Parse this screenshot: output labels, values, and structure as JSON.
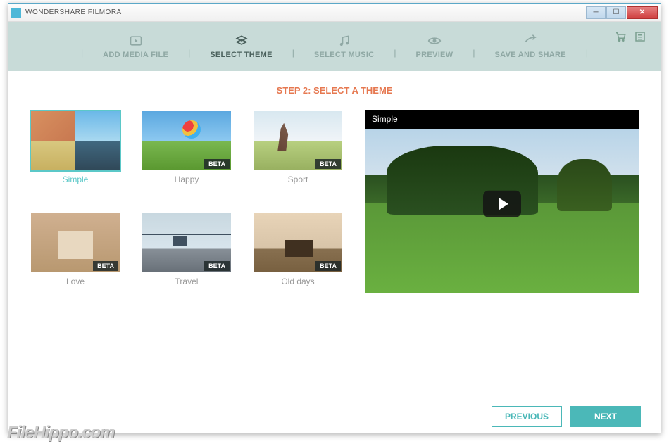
{
  "window": {
    "title": "WONDERSHARE FILMORA"
  },
  "nav": {
    "items": [
      {
        "label": "ADD MEDIA FILE",
        "icon": "media-icon"
      },
      {
        "label": "SELECT THEME",
        "icon": "theme-icon"
      },
      {
        "label": "SELECT MUSIC",
        "icon": "music-icon"
      },
      {
        "label": "PREVIEW",
        "icon": "preview-icon"
      },
      {
        "label": "SAVE AND SHARE",
        "icon": "share-icon"
      }
    ],
    "active_index": 1
  },
  "step": {
    "title": "STEP 2: SELECT A THEME"
  },
  "themes": [
    {
      "name": "Simple",
      "selected": true,
      "beta": false
    },
    {
      "name": "Happy",
      "selected": false,
      "beta": true
    },
    {
      "name": "Sport",
      "selected": false,
      "beta": true
    },
    {
      "name": "Love",
      "selected": false,
      "beta": true
    },
    {
      "name": "Travel",
      "selected": false,
      "beta": true
    },
    {
      "name": "Old days",
      "selected": false,
      "beta": true
    }
  ],
  "beta_label": "BETA",
  "preview": {
    "title": "Simple"
  },
  "buttons": {
    "previous": "PREVIOUS",
    "next": "NEXT"
  },
  "watermark": "FileHippo.com"
}
